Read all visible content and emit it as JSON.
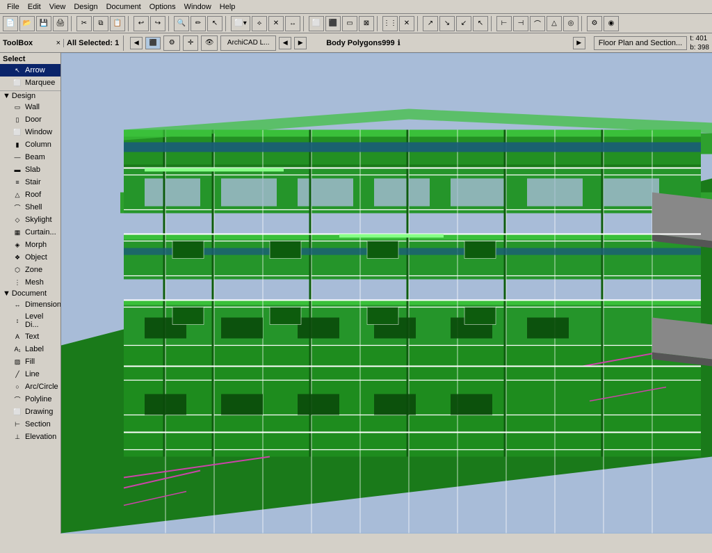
{
  "menubar": {
    "items": [
      "File",
      "Edit",
      "View",
      "Design",
      "Document",
      "Options",
      "Window",
      "Help"
    ]
  },
  "toolbox": {
    "title": "ToolBox",
    "close_btn": "×",
    "select_section": "Select",
    "select_items": [
      {
        "name": "Arrow",
        "icon": "↖"
      },
      {
        "name": "Marquee",
        "icon": "⬜"
      }
    ],
    "design_section": "Design",
    "design_items": [
      {
        "name": "Wall",
        "icon": "▭"
      },
      {
        "name": "Door",
        "icon": "▯"
      },
      {
        "name": "Window",
        "icon": "⬜"
      },
      {
        "name": "Column",
        "icon": "▮"
      },
      {
        "name": "Beam",
        "icon": "—"
      },
      {
        "name": "Slab",
        "icon": "▬"
      },
      {
        "name": "Stair",
        "icon": "≡"
      },
      {
        "name": "Roof",
        "icon": "△"
      },
      {
        "name": "Shell",
        "icon": "⌒"
      },
      {
        "name": "Skylight",
        "icon": "◇"
      },
      {
        "name": "Curtain...",
        "icon": "▦"
      },
      {
        "name": "Morph",
        "icon": "◈"
      },
      {
        "name": "Object",
        "icon": "❖"
      },
      {
        "name": "Zone",
        "icon": "⬡"
      },
      {
        "name": "Mesh",
        "icon": "⋮"
      }
    ],
    "document_section": "Document",
    "document_items": [
      {
        "name": "Dimension",
        "icon": "↔"
      },
      {
        "name": "Level Di...",
        "icon": "↕"
      },
      {
        "name": "Text",
        "icon": "A"
      },
      {
        "name": "Label",
        "icon": "A₁"
      },
      {
        "name": "Fill",
        "icon": "▨"
      },
      {
        "name": "Line",
        "icon": "╱"
      },
      {
        "name": "Arc/Circle",
        "icon": "○"
      },
      {
        "name": "Polyline",
        "icon": "⌒"
      },
      {
        "name": "Drawing",
        "icon": "⬜"
      },
      {
        "name": "Section",
        "icon": "⊢"
      },
      {
        "name": "Elevation",
        "icon": "⊥"
      }
    ]
  },
  "info_bar": {
    "all_selected": "All Selected: 1",
    "body_polygons": "Body Polygons999",
    "info_icon": "ℹ",
    "floor_plan_btn": "Floor Plan and Section...",
    "coord_t": "t: 401",
    "coord_b": "b: 398"
  },
  "viewport": {
    "bg_color": "#87aace",
    "building_color": "#2a8a2a",
    "building_light": "#3ab03a",
    "building_dark": "#1a6a1a",
    "line_color": "#ffffff",
    "accent_color": "#cc44cc"
  }
}
